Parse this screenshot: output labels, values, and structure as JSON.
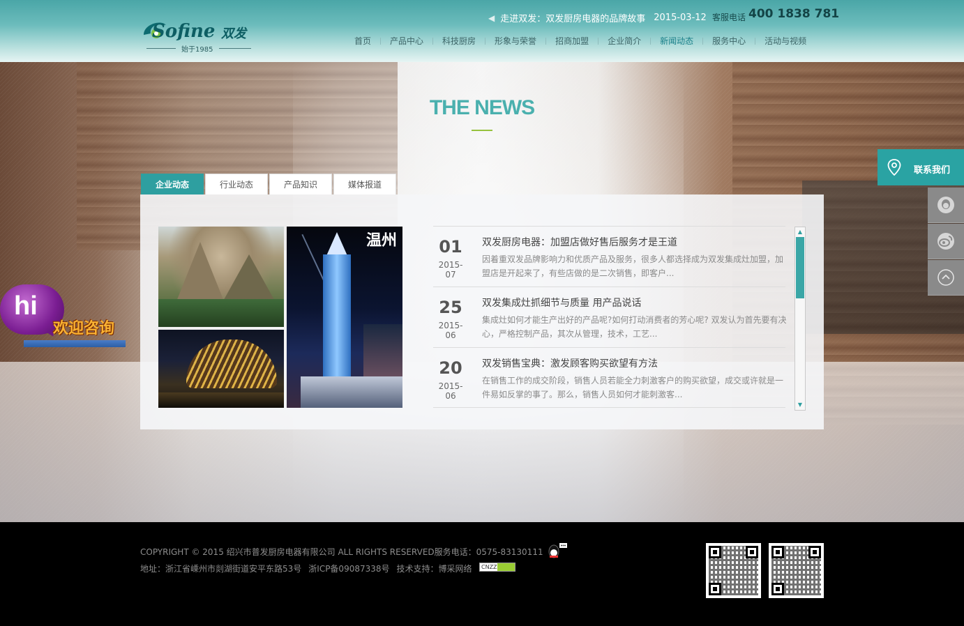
{
  "header": {
    "logo": {
      "brand_en": "Sofine",
      "brand_cn": "双发",
      "since": "始于1985"
    },
    "announcement": {
      "text": "走进双发：双发厨房电器的品牌故事",
      "date": "2015-03-12"
    },
    "hotline": {
      "label": "客服电话",
      "number": "400 1838 781"
    },
    "nav": [
      {
        "label": "首页"
      },
      {
        "label": "产品中心"
      },
      {
        "label": "科技厨房"
      },
      {
        "label": "形象与荣誉"
      },
      {
        "label": "招商加盟"
      },
      {
        "label": "企业简介"
      },
      {
        "label": "新闻动态",
        "active": true
      },
      {
        "label": "服务中心"
      },
      {
        "label": "活动与视频"
      }
    ]
  },
  "section": {
    "title": "THE NEWS"
  },
  "tabs": [
    {
      "label": "企业动态",
      "active": true
    },
    {
      "label": "行业动态"
    },
    {
      "label": "产品知识"
    },
    {
      "label": "媒体报道"
    }
  ],
  "photos": {
    "caption": "温州"
  },
  "news": [
    {
      "day": "01",
      "ym": "2015-07",
      "title": "双发厨房电器：加盟店做好售后服务才是王道",
      "desc": "因着重双发品牌影响力和优质产品及服务，很多人都选择成为双发集成灶加盟，加盟店是开起来了，有些店做的是二次销售，即客户..."
    },
    {
      "day": "25",
      "ym": "2015-06",
      "title": "双发集成灶抓细节与质量 用产品说话",
      "desc": "集成灶如何才能生产出好的产品呢?如何打动消费者的芳心呢? 双发认为首先要有决心，严格控制产品，其次从管理，技术，工艺..."
    },
    {
      "day": "20",
      "ym": "2015-06",
      "title": "双发销售宝典：激发顾客购买欲望有方法",
      "desc": "在销售工作的成交阶段，销售人员若能全力刺激客户的购买欲望，成交或许就是一件易如反掌的事了。那么，销售人员如何才能刺激客..."
    }
  ],
  "contact": {
    "label": "联系我们"
  },
  "hi_widget": {
    "hi": "hi",
    "label": "欢迎咨询"
  },
  "footer": {
    "copyright": "COPYRIGHT © 2015 绍兴市普发厨房电器有限公司 ALL RIGHTS RESERVED服务电话：0575-83130111",
    "address": "地址：浙江省嵊州市剡湖街道安平东路53号",
    "icp": "浙ICP备09087338号",
    "support": "技术支持：博采网络",
    "cnzz": "CNZZ"
  },
  "colors": {
    "accent": "#2e9fa0",
    "header_top": "#4aa6a7",
    "title": "#4ab0ae",
    "underline": "#96c23e"
  }
}
